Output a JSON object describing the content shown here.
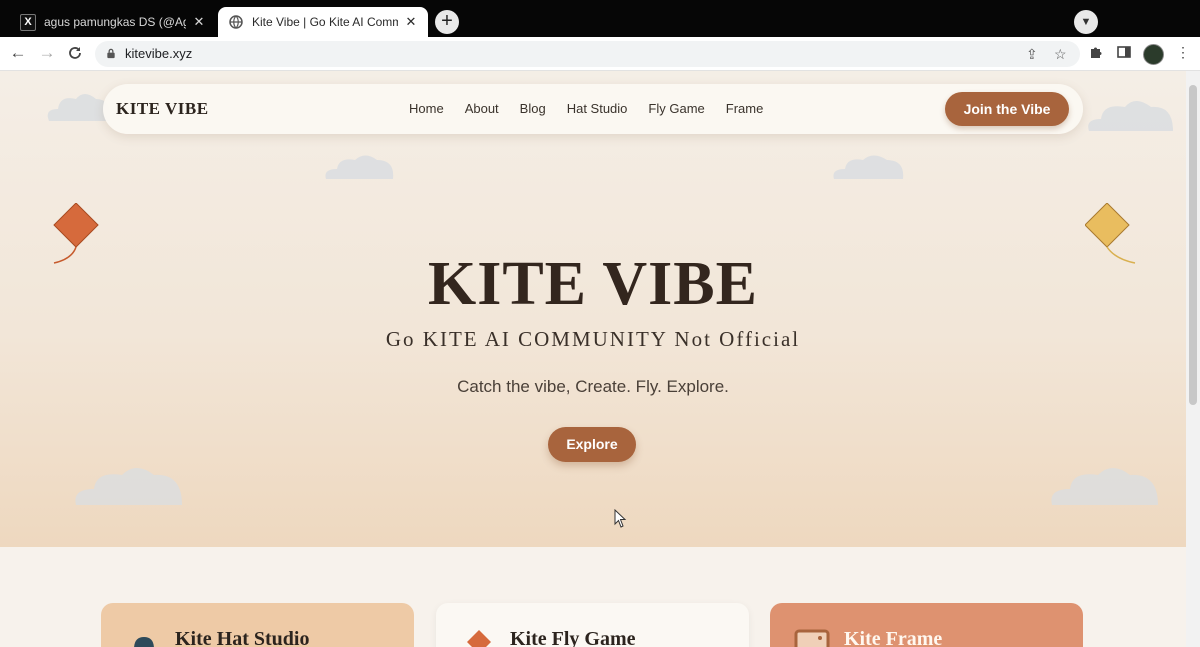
{
  "browser": {
    "tabs": [
      {
        "title": "agus pamungkas DS (@Agus_pa",
        "active": false,
        "favicon": "x-logo-icon"
      },
      {
        "title": "Kite Vibe | Go Kite AI Community",
        "active": true,
        "favicon": "globe-icon"
      }
    ],
    "url": "kitevibe.xyz"
  },
  "site": {
    "brand": "KITE VIBE",
    "nav": [
      "Home",
      "About",
      "Blog",
      "Hat Studio",
      "Fly Game",
      "Frame"
    ],
    "cta": "Join the Vibe"
  },
  "hero": {
    "title": "KITE VIBE",
    "subtitle": "Go KITE AI COMMUNITY Not Official",
    "tagline": "Catch the vibe, Create. Fly. Explore.",
    "button": "Explore"
  },
  "cards": [
    {
      "title": "Kite Hat Studio",
      "icon": "hat-icon"
    },
    {
      "title": "Kite Fly Game",
      "icon": "kite-icon"
    },
    {
      "title": "Kite Frame",
      "icon": "frame-icon"
    }
  ],
  "colors": {
    "accent": "#a8643d",
    "hero_text": "#33261e",
    "card_hat": "#eecaa6",
    "card_game": "#fbf8f3",
    "card_frame": "#de9270",
    "kite_left": "#d66a3c",
    "kite_right": "#e9bd5f"
  }
}
